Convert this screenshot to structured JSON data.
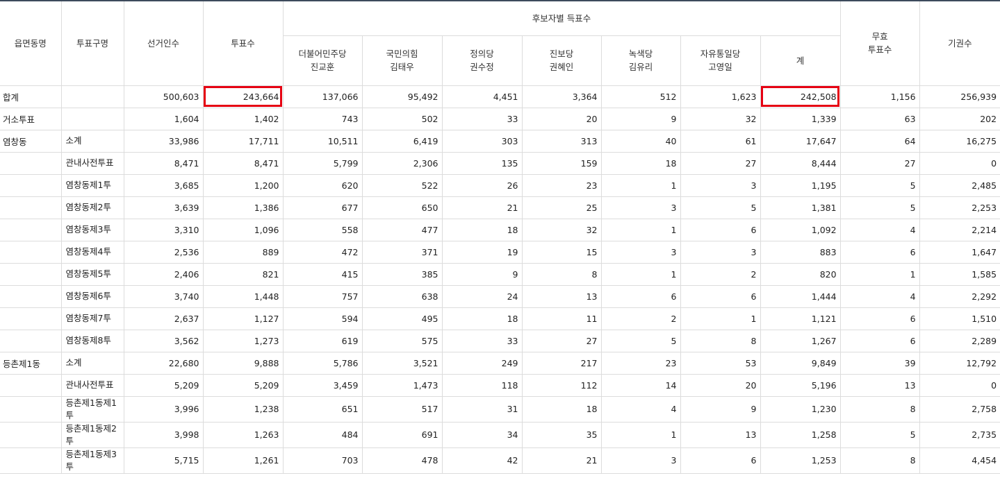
{
  "headers": {
    "district": "읍면동명",
    "polling_place": "투표구명",
    "electorate": "선거인수",
    "votes_cast": "투표수",
    "candidate_group": "후보자별 득표수",
    "candidates": [
      [
        "더불어민주당",
        "진교훈"
      ],
      [
        "국민의힘",
        "김태우"
      ],
      [
        "정의당",
        "권수정"
      ],
      [
        "진보당",
        "권혜인"
      ],
      [
        "녹색당",
        "김유리"
      ],
      [
        "자유통일당",
        "고영일"
      ]
    ],
    "total": "계",
    "invalid": [
      "무효",
      "투표수"
    ],
    "abstain": "기권수"
  },
  "rows": [
    {
      "d": "합계",
      "p": "",
      "v": [
        "500,603",
        "243,664",
        "137,066",
        "95,492",
        "4,451",
        "3,364",
        "512",
        "1,623",
        "242,508",
        "1,156",
        "256,939"
      ]
    },
    {
      "d": "거소투표",
      "p": "",
      "v": [
        "1,604",
        "1,402",
        "743",
        "502",
        "33",
        "20",
        "9",
        "32",
        "1,339",
        "63",
        "202"
      ]
    },
    {
      "d": "염창동",
      "p": "소계",
      "v": [
        "33,986",
        "17,711",
        "10,511",
        "6,419",
        "303",
        "313",
        "40",
        "61",
        "17,647",
        "64",
        "16,275"
      ]
    },
    {
      "d": "",
      "p": "관내사전투표",
      "v": [
        "8,471",
        "8,471",
        "5,799",
        "2,306",
        "135",
        "159",
        "18",
        "27",
        "8,444",
        "27",
        "0"
      ]
    },
    {
      "d": "",
      "p": "염창동제1투",
      "v": [
        "3,685",
        "1,200",
        "620",
        "522",
        "26",
        "23",
        "1",
        "3",
        "1,195",
        "5",
        "2,485"
      ]
    },
    {
      "d": "",
      "p": "염창동제2투",
      "v": [
        "3,639",
        "1,386",
        "677",
        "650",
        "21",
        "25",
        "3",
        "5",
        "1,381",
        "5",
        "2,253"
      ]
    },
    {
      "d": "",
      "p": "염창동제3투",
      "v": [
        "3,310",
        "1,096",
        "558",
        "477",
        "18",
        "32",
        "1",
        "6",
        "1,092",
        "4",
        "2,214"
      ]
    },
    {
      "d": "",
      "p": "염창동제4투",
      "v": [
        "2,536",
        "889",
        "472",
        "371",
        "19",
        "15",
        "3",
        "3",
        "883",
        "6",
        "1,647"
      ]
    },
    {
      "d": "",
      "p": "염창동제5투",
      "v": [
        "2,406",
        "821",
        "415",
        "385",
        "9",
        "8",
        "1",
        "2",
        "820",
        "1",
        "1,585"
      ]
    },
    {
      "d": "",
      "p": "염창동제6투",
      "v": [
        "3,740",
        "1,448",
        "757",
        "638",
        "24",
        "13",
        "6",
        "6",
        "1,444",
        "4",
        "2,292"
      ]
    },
    {
      "d": "",
      "p": "염창동제7투",
      "v": [
        "2,637",
        "1,127",
        "594",
        "495",
        "18",
        "11",
        "2",
        "1",
        "1,121",
        "6",
        "1,510"
      ]
    },
    {
      "d": "",
      "p": "염창동제8투",
      "v": [
        "3,562",
        "1,273",
        "619",
        "575",
        "33",
        "27",
        "5",
        "8",
        "1,267",
        "6",
        "2,289"
      ]
    },
    {
      "d": "등촌제1동",
      "p": "소계",
      "v": [
        "22,680",
        "9,888",
        "5,786",
        "3,521",
        "249",
        "217",
        "23",
        "53",
        "9,849",
        "39",
        "12,792"
      ]
    },
    {
      "d": "",
      "p": "관내사전투표",
      "v": [
        "5,209",
        "5,209",
        "3,459",
        "1,473",
        "118",
        "112",
        "14",
        "20",
        "5,196",
        "13",
        "0"
      ]
    },
    {
      "d": "",
      "p": "등촌제1동제1투",
      "v": [
        "3,996",
        "1,238",
        "651",
        "517",
        "31",
        "18",
        "4",
        "9",
        "1,230",
        "8",
        "2,758"
      ]
    },
    {
      "d": "",
      "p": "등촌제1동제2투",
      "v": [
        "3,998",
        "1,263",
        "484",
        "691",
        "34",
        "35",
        "1",
        "13",
        "1,258",
        "5",
        "2,735"
      ]
    },
    {
      "d": "",
      "p": "등촌제1동제3투",
      "v": [
        "5,715",
        "1,261",
        "703",
        "478",
        "42",
        "21",
        "3",
        "6",
        "1,253",
        "8",
        "4,454"
      ]
    }
  ]
}
